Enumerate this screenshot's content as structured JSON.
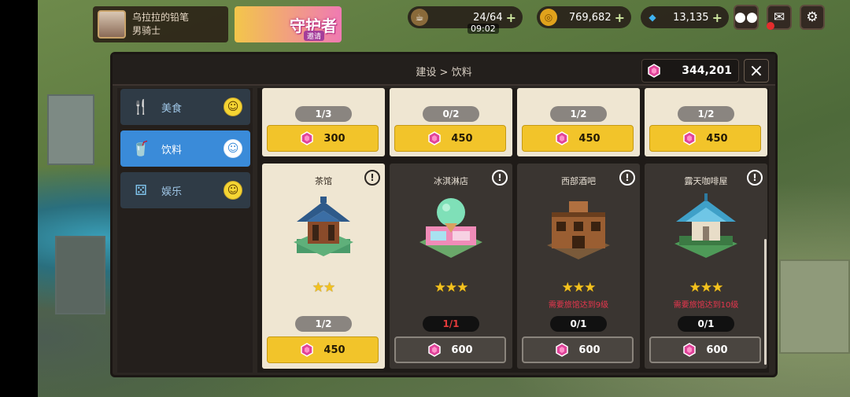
{
  "player": {
    "name": "乌拉拉的铅笔",
    "class": "男骑士"
  },
  "banner": {
    "title": "守护者",
    "subtitle": "邀请"
  },
  "resources": {
    "coffee": {
      "value": "24/64",
      "timer": "09:02"
    },
    "gold": {
      "value": "769,682"
    },
    "diamond": {
      "value": "13,135"
    }
  },
  "header": {
    "breadcrumb": "建设 > 饮料",
    "balance": "344,201",
    "close": "×"
  },
  "tabs": [
    {
      "label": "美食",
      "icon": "cutlery-icon"
    },
    {
      "label": "饮料",
      "icon": "cup-icon"
    },
    {
      "label": "娱乐",
      "icon": "dice-icon"
    }
  ],
  "top_row": [
    {
      "count": "1/3",
      "price": "300"
    },
    {
      "count": "0/2",
      "price": "450"
    },
    {
      "count": "1/2",
      "price": "450"
    },
    {
      "count": "1/2",
      "price": "450"
    }
  ],
  "cards": [
    {
      "name": "茶馆",
      "stars": "★★",
      "requirement": "",
      "count": "1/2",
      "price": "450"
    },
    {
      "name": "冰淇淋店",
      "stars": "★★★",
      "requirement": "",
      "count": "1/1",
      "price": "600"
    },
    {
      "name": "西部酒吧",
      "stars": "★★★",
      "requirement": "需要旅馆达到9级",
      "count": "0/1",
      "price": "600"
    },
    {
      "name": "露天咖啡屋",
      "stars": "★★★",
      "requirement": "需要旅馆达到10级",
      "count": "0/1",
      "price": "600"
    }
  ],
  "colors": {
    "accent_blue": "#3a8bd9",
    "button_yellow": "#f2c42a",
    "gem_pink": "#e0449a",
    "warning_red": "#e8364e"
  }
}
